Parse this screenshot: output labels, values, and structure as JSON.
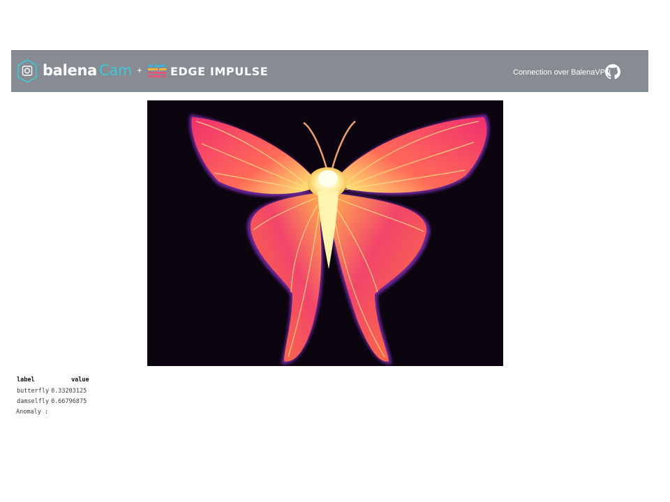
{
  "header": {
    "brand_balena": "balena",
    "brand_cam": "Cam",
    "plus": "+",
    "partner": "EDGE IMPULSE",
    "connection": "Connection over BalenaVPN",
    "logo_icon": "balena-cube-icon",
    "partner_icon": "edge-impulse-icon",
    "repo_icon": "github-icon",
    "colors": {
      "bar": "#868c91",
      "cam_accent": "#3fc7d7"
    }
  },
  "camera": {
    "subject": "thermal-butterfly-image"
  },
  "results": {
    "headers": [
      "label",
      "value"
    ],
    "rows": [
      {
        "label": "butterfly",
        "value": "0.33203125"
      },
      {
        "label": "damselfly",
        "value": "0.66796875"
      }
    ],
    "anomaly_label": "Anomaly",
    "anomaly_value": ":"
  }
}
